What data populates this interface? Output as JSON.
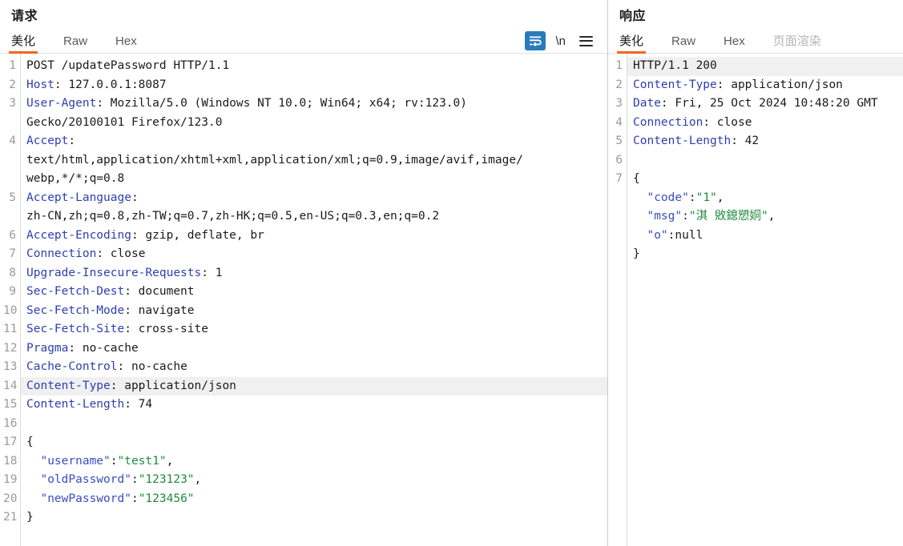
{
  "request": {
    "title": "请求",
    "tabs": [
      {
        "label": "美化",
        "active": true
      },
      {
        "label": "Raw",
        "active": false
      },
      {
        "label": "Hex",
        "active": false
      }
    ],
    "actions": {
      "wrap_icon": "word-wrap-icon",
      "newline_label": "\\n",
      "menu_icon": "hamburger-menu-icon"
    },
    "accent_color": "#f26522",
    "highlight_color": "#2b7bba",
    "highlighted_line": 14,
    "lines": [
      {
        "num": "1",
        "segments": [
          {
            "t": "POST /updatePassword HTTP/1.1",
            "c": "hval"
          }
        ]
      },
      {
        "num": "2",
        "segments": [
          {
            "t": "Host",
            "c": "hname"
          },
          {
            "t": ": 127.0.0.1:8087",
            "c": "hval"
          }
        ]
      },
      {
        "num": "3",
        "segments": [
          {
            "t": "User-Agent",
            "c": "hname"
          },
          {
            "t": ": Mozilla/5.0 (Windows NT 10.0; Win64; x64; rv:123.0)",
            "c": "hval"
          }
        ]
      },
      {
        "num": "",
        "segments": [
          {
            "t": "Gecko/20100101 Firefox/123.0",
            "c": "hval"
          }
        ]
      },
      {
        "num": "4",
        "segments": [
          {
            "t": "Accept",
            "c": "hname"
          },
          {
            "t": ":",
            "c": "hval"
          }
        ]
      },
      {
        "num": "",
        "segments": [
          {
            "t": "text/html,application/xhtml+xml,application/xml;q=0.9,image/avif,image/",
            "c": "hval"
          }
        ]
      },
      {
        "num": "",
        "segments": [
          {
            "t": "webp,*/*;q=0.8",
            "c": "hval"
          }
        ]
      },
      {
        "num": "5",
        "segments": [
          {
            "t": "Accept-Language",
            "c": "hname"
          },
          {
            "t": ":",
            "c": "hval"
          }
        ]
      },
      {
        "num": "",
        "segments": [
          {
            "t": "zh-CN,zh;q=0.8,zh-TW;q=0.7,zh-HK;q=0.5,en-US;q=0.3,en;q=0.2",
            "c": "hval"
          }
        ]
      },
      {
        "num": "6",
        "segments": [
          {
            "t": "Accept-Encoding",
            "c": "hname"
          },
          {
            "t": ": gzip, deflate, br",
            "c": "hval"
          }
        ]
      },
      {
        "num": "7",
        "segments": [
          {
            "t": "Connection",
            "c": "hname"
          },
          {
            "t": ": close",
            "c": "hval"
          }
        ]
      },
      {
        "num": "8",
        "segments": [
          {
            "t": "Upgrade-Insecure-Requests",
            "c": "hname"
          },
          {
            "t": ": 1",
            "c": "hval"
          }
        ]
      },
      {
        "num": "9",
        "segments": [
          {
            "t": "Sec-Fetch-Dest",
            "c": "hname"
          },
          {
            "t": ": document",
            "c": "hval"
          }
        ]
      },
      {
        "num": "10",
        "segments": [
          {
            "t": "Sec-Fetch-Mode",
            "c": "hname"
          },
          {
            "t": ": navigate",
            "c": "hval"
          }
        ]
      },
      {
        "num": "11",
        "segments": [
          {
            "t": "Sec-Fetch-Site",
            "c": "hname"
          },
          {
            "t": ": cross-site",
            "c": "hval"
          }
        ]
      },
      {
        "num": "12",
        "segments": [
          {
            "t": "Pragma",
            "c": "hname"
          },
          {
            "t": ": no-cache",
            "c": "hval"
          }
        ]
      },
      {
        "num": "13",
        "segments": [
          {
            "t": "Cache-Control",
            "c": "hname"
          },
          {
            "t": ": no-cache",
            "c": "hval"
          }
        ]
      },
      {
        "num": "14",
        "hl": true,
        "segments": [
          {
            "t": "Content-Type",
            "c": "hname"
          },
          {
            "t": ": application/json",
            "c": "hval"
          }
        ]
      },
      {
        "num": "15",
        "segments": [
          {
            "t": "Content-Length",
            "c": "hname"
          },
          {
            "t": ": 74",
            "c": "hval"
          }
        ]
      },
      {
        "num": "16",
        "segments": [
          {
            "t": "",
            "c": "hval"
          }
        ]
      },
      {
        "num": "17",
        "segments": [
          {
            "t": "{",
            "c": "jpun"
          }
        ]
      },
      {
        "num": "18",
        "segments": [
          {
            "t": "  ",
            "c": "jpun"
          },
          {
            "t": "\"username\"",
            "c": "jkey"
          },
          {
            "t": ":",
            "c": "jpun"
          },
          {
            "t": "\"test1\"",
            "c": "jstr"
          },
          {
            "t": ",",
            "c": "jpun"
          }
        ]
      },
      {
        "num": "19",
        "segments": [
          {
            "t": "  ",
            "c": "jpun"
          },
          {
            "t": "\"oldPassword\"",
            "c": "jkey"
          },
          {
            "t": ":",
            "c": "jpun"
          },
          {
            "t": "\"123123\"",
            "c": "jstr"
          },
          {
            "t": ",",
            "c": "jpun"
          }
        ]
      },
      {
        "num": "20",
        "segments": [
          {
            "t": "  ",
            "c": "jpun"
          },
          {
            "t": "\"newPassword\"",
            "c": "jkey"
          },
          {
            "t": ":",
            "c": "jpun"
          },
          {
            "t": "\"123456\"",
            "c": "jstr"
          }
        ]
      },
      {
        "num": "21",
        "segments": [
          {
            "t": "}",
            "c": "jpun"
          }
        ]
      }
    ]
  },
  "response": {
    "title": "响应",
    "tabs": [
      {
        "label": "美化",
        "active": true
      },
      {
        "label": "Raw",
        "active": false
      },
      {
        "label": "Hex",
        "active": false
      },
      {
        "label": "页面渲染",
        "active": false,
        "disabled": true
      }
    ],
    "highlighted_line": 1,
    "lines": [
      {
        "num": "1",
        "hl": true,
        "segments": [
          {
            "t": "HTTP/1.1 200",
            "c": "hval"
          }
        ]
      },
      {
        "num": "2",
        "segments": [
          {
            "t": "Content-Type",
            "c": "hname"
          },
          {
            "t": ": application/json",
            "c": "hval"
          }
        ]
      },
      {
        "num": "3",
        "segments": [
          {
            "t": "Date",
            "c": "hname"
          },
          {
            "t": ": Fri, 25 Oct 2024 10:48:20 GMT",
            "c": "hval"
          }
        ]
      },
      {
        "num": "4",
        "segments": [
          {
            "t": "Connection",
            "c": "hname"
          },
          {
            "t": ": close",
            "c": "hval"
          }
        ]
      },
      {
        "num": "5",
        "segments": [
          {
            "t": "Content-Length",
            "c": "hname"
          },
          {
            "t": ": 42",
            "c": "hval"
          }
        ]
      },
      {
        "num": "6",
        "segments": [
          {
            "t": "",
            "c": "hval"
          }
        ]
      },
      {
        "num": "7",
        "segments": [
          {
            "t": "{",
            "c": "jpun"
          }
        ]
      },
      {
        "num": "",
        "segments": [
          {
            "t": "  ",
            "c": "jpun"
          },
          {
            "t": "\"code\"",
            "c": "jkey"
          },
          {
            "t": ":",
            "c": "jpun"
          },
          {
            "t": "\"1\"",
            "c": "jstr"
          },
          {
            "t": ",",
            "c": "jpun"
          }
        ]
      },
      {
        "num": "",
        "segments": [
          {
            "t": "  ",
            "c": "jpun"
          },
          {
            "t": "\"msg\"",
            "c": "jkey"
          },
          {
            "t": ":",
            "c": "jpun"
          },
          {
            "t": "\"淇 敓鎴愬姛\"",
            "c": "jstr"
          },
          {
            "t": ",",
            "c": "jpun"
          }
        ]
      },
      {
        "num": "",
        "segments": [
          {
            "t": "  ",
            "c": "jpun"
          },
          {
            "t": "\"o\"",
            "c": "jkey"
          },
          {
            "t": ":",
            "c": "jpun"
          },
          {
            "t": "null",
            "c": "jnull"
          }
        ]
      },
      {
        "num": "",
        "segments": [
          {
            "t": "}",
            "c": "jpun"
          }
        ]
      }
    ]
  }
}
